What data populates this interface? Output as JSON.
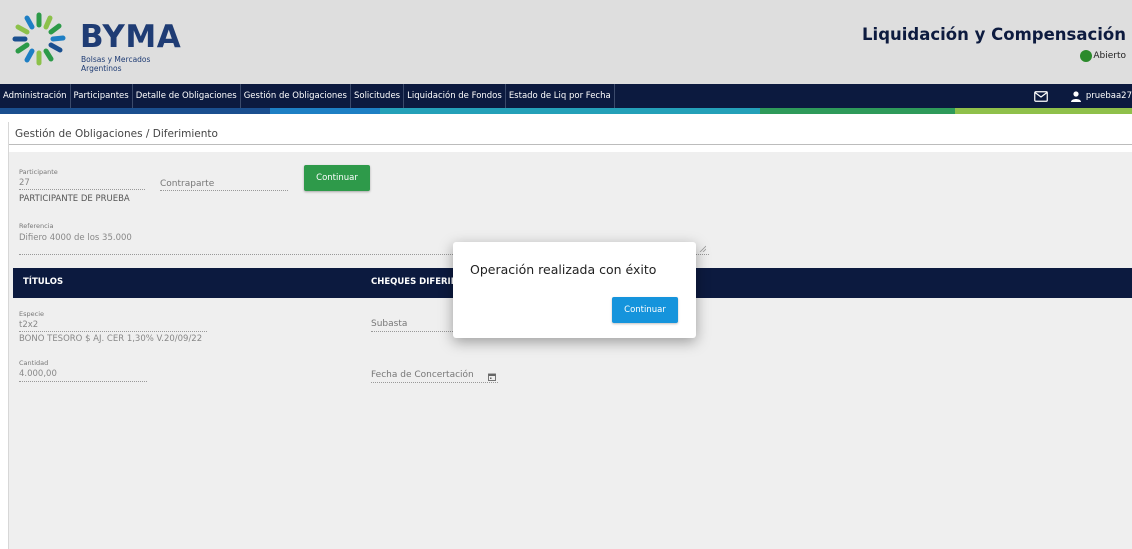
{
  "header": {
    "logo_text": "BYMA",
    "logo_sub_1": "Bolsas y Mercados",
    "logo_sub_2": "Argentinos",
    "app_title": "Liquidación y Compensación",
    "status_text": "Abierto",
    "status_color": "#2b8a2b"
  },
  "nav": {
    "items": [
      {
        "label": "Administración"
      },
      {
        "label": "Participantes"
      },
      {
        "label": "Detalle de Obligaciones"
      },
      {
        "label": "Gestión de Obligaciones"
      },
      {
        "label": "Solicitudes"
      },
      {
        "label": "Liquidación de Fondos"
      },
      {
        "label": "Estado de Liq por Fecha"
      }
    ],
    "mail_icon": "mail-icon",
    "user_icon": "user-icon",
    "username": "pruebaa27",
    "color_bar": [
      "#1a4f8f",
      "#1d7fc4",
      "#24a0b8",
      "#2e9a5a",
      "#8fc04a"
    ]
  },
  "page": {
    "breadcrumb": "Gestión de Obligaciones / Diferimiento",
    "participante_label": "Participante",
    "participante_value": "27",
    "participante_name": "PARTICIPANTE DE PRUEBA",
    "contraparte_placeholder": "Contraparte",
    "continuar_label": "Continuar",
    "referencia_label": "Referencia",
    "referencia_value": "Difiero 4000 de los 35.000",
    "titulos_header": "TÍTULOS",
    "cheques_header": "CHEQUES DIFERIDOS",
    "especie_label": "Especie",
    "especie_value": "t2x2",
    "especie_desc": "BONO TESORO $ AJ. CER 1,30% V.20/09/22",
    "cantidad_label": "Cantidad",
    "cantidad_value": "4.000,00",
    "subasta_placeholder": "Subasta",
    "fecha_placeholder": "Fecha de Concertación"
  },
  "modal": {
    "message": "Operación realizada con éxito",
    "button_label": "Continuar"
  }
}
